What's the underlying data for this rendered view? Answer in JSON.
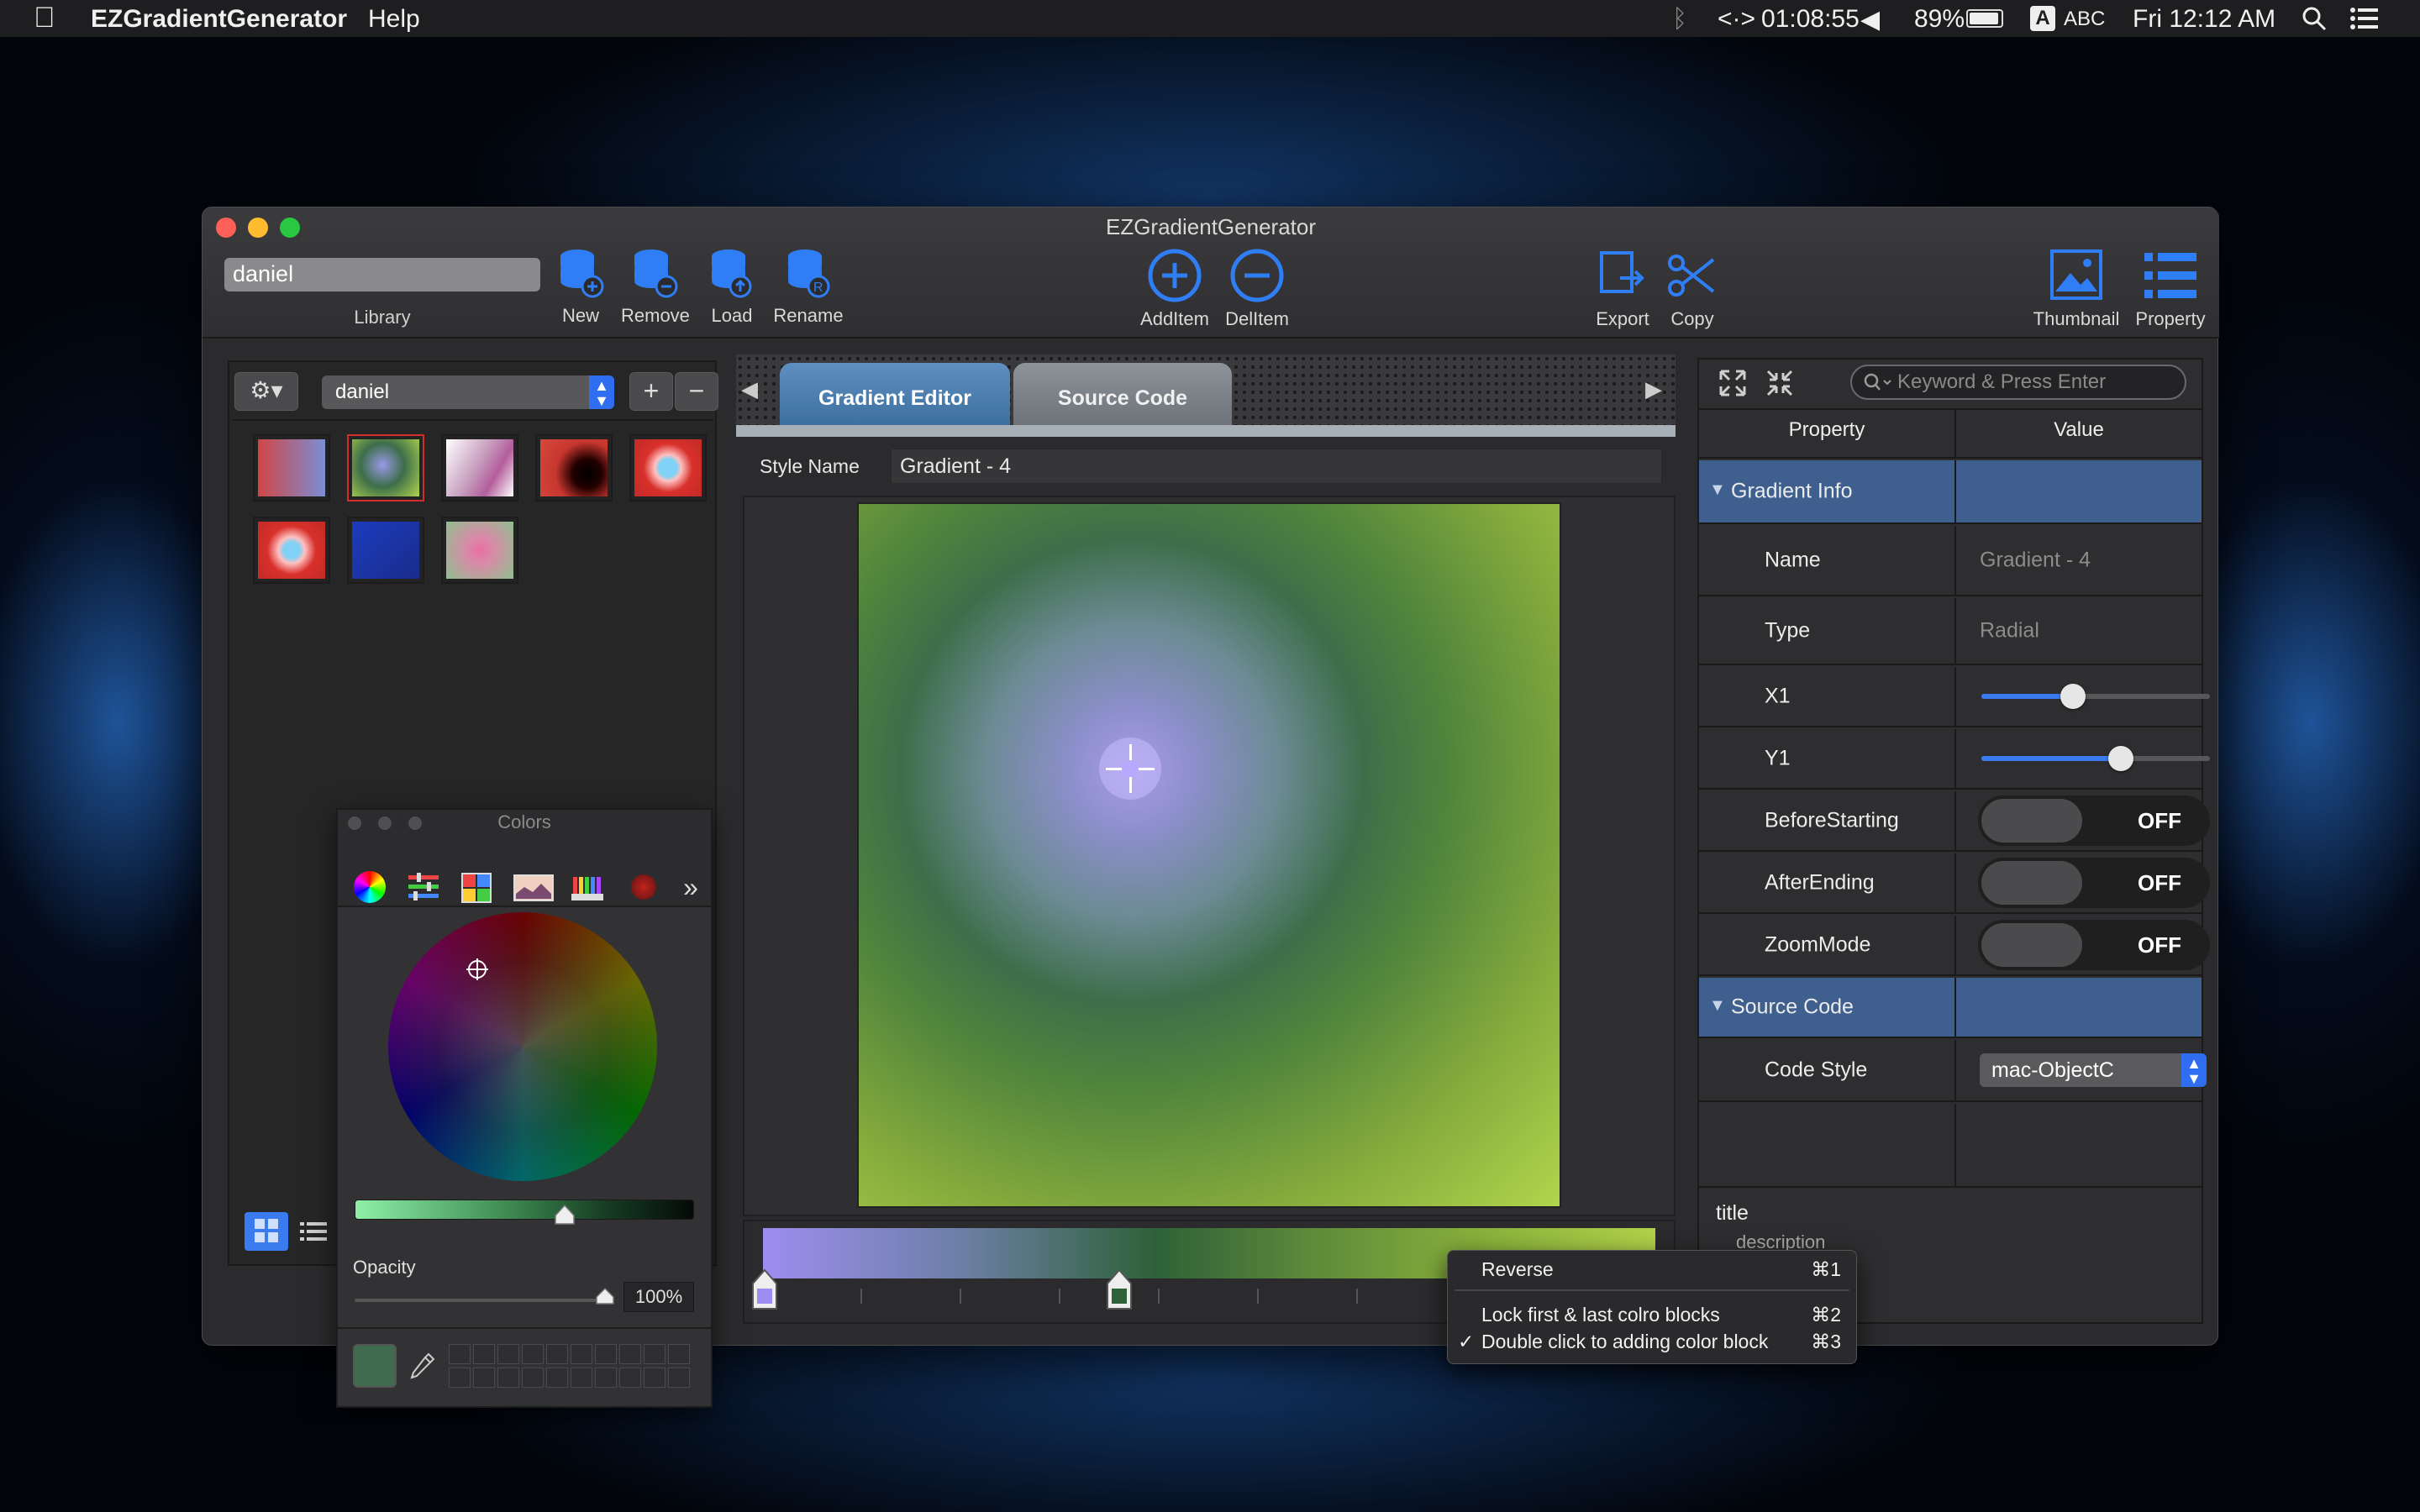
{
  "menubar": {
    "app_name": "EZGradientGenerator",
    "menus": [
      "Help"
    ],
    "status": {
      "timer": "01:08:55",
      "battery": "89%",
      "input_source": "ABC",
      "input_badge": "A",
      "clock": "Fri 12:12 AM"
    }
  },
  "window": {
    "title": "EZGradientGenerator",
    "library_field": "daniel",
    "library_label": "Library",
    "toolbar": {
      "new": "New",
      "remove": "Remove",
      "load": "Load",
      "rename": "Rename",
      "add_item": "AddItem",
      "del_item": "DelItem",
      "export": "Export",
      "copy": "Copy",
      "thumbnail": "Thumbnail",
      "property": "Property"
    }
  },
  "left_panel": {
    "library_select": "daniel",
    "add_label": "+",
    "remove_label": "−"
  },
  "editor": {
    "tabs": [
      "Gradient Editor",
      "Source Code"
    ],
    "active_tab": "Gradient Editor",
    "style_name_label": "Style Name",
    "style_name_value": "Gradient - 4"
  },
  "properties": {
    "search_placeholder": "Keyword & Press Enter",
    "col_property": "Property",
    "col_value": "Value",
    "section_info": "Gradient Info",
    "name_label": "Name",
    "name_value": "Gradient - 4",
    "type_label": "Type",
    "type_value": "Radial",
    "x1_label": "X1",
    "x1_value": 0.4,
    "y1_label": "Y1",
    "y1_value": 0.61,
    "before_label": "BeforeStarting",
    "before_value": "OFF",
    "after_label": "AfterEnding",
    "after_value": "OFF",
    "zoom_label": "ZoomMode",
    "zoom_value": "OFF",
    "section_source": "Source Code",
    "code_style_label": "Code Style",
    "code_style_value": "mac-ObjectC",
    "footer_title": "title",
    "footer_description": "description"
  },
  "colors_panel": {
    "title": "Colors",
    "opacity_label": "Opacity",
    "opacity_value": "100%",
    "opacity_level": 1.0,
    "brightness_level": 0.62
  },
  "context_menu": {
    "items": [
      {
        "label": "Reverse",
        "shortcut": "⌘1"
      },
      {
        "label": "Lock first & last colro blocks",
        "shortcut": "⌘2"
      },
      {
        "label": "Double click to adding color block",
        "shortcut": "⌘3",
        "checked": true
      }
    ]
  },
  "colors": {
    "accent": "#2f6ef0",
    "selected_border": "#d22d2d",
    "section_blue": "#3f5f8f"
  }
}
